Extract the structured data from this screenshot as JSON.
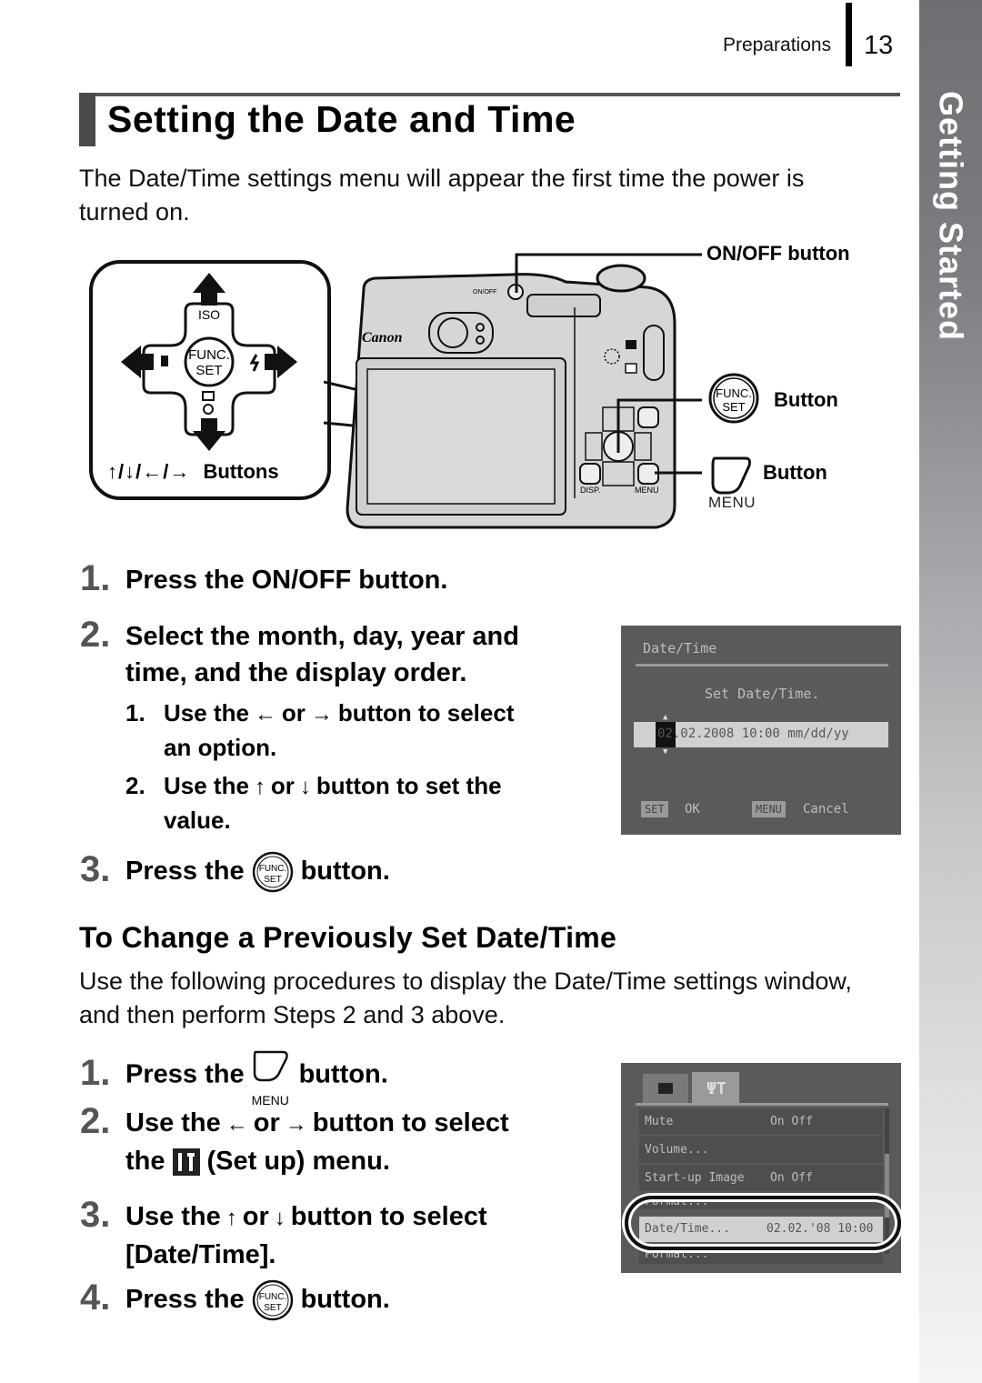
{
  "header": {
    "section": "Preparations",
    "page_number": "13"
  },
  "side_tab": {
    "label": "Getting Started"
  },
  "title": "Setting the Date and Time",
  "intro": "The Date/Time settings menu will appear the first time the power is turned on.",
  "diagram": {
    "dpad": {
      "caption_arrows": "↑/↓/←/→",
      "caption_label": "Buttons",
      "center_label_top": "FUNC.",
      "center_label_bottom": "SET",
      "up_label": "ISO"
    },
    "camera": {
      "brand": "Canon",
      "onoff_text": "ON/OFF",
      "disp_text": "DISP.",
      "menu_text": "MENU"
    },
    "callouts": {
      "onoff": "ON/OFF button",
      "func_set": "Button",
      "menu": "Button",
      "menu_under": "MENU",
      "func_top": "FUNC.",
      "func_bottom": "SET"
    }
  },
  "steps_main": [
    {
      "num": "1.",
      "text": "Press the ON/OFF button."
    },
    {
      "num": "2.",
      "text_line1": "Select the month, day, year and",
      "text_line2": "time, and the display order.",
      "substeps": [
        {
          "num": "1.",
          "pre": "Use the",
          "icon1": "←",
          "mid": "or",
          "icon2": "→",
          "post": "button to select",
          "line2": "an option."
        },
        {
          "num": "2.",
          "pre": "Use the",
          "icon1": "↑",
          "mid": "or",
          "icon2": "↓",
          "post": "button to set the",
          "line2": "value."
        }
      ]
    },
    {
      "num": "3.",
      "pre": "Press the",
      "post": "button."
    }
  ],
  "lcd_datetime": {
    "title": "Date/Time",
    "prompt": "Set Date/Time.",
    "value": "02.02.2008 10:00 mm/dd/yy",
    "ok_key": "SET",
    "ok_label": "OK",
    "cancel_key": "MENU",
    "cancel_label": "Cancel"
  },
  "section2": {
    "title": "To Change a Previously Set Date/Time",
    "body": "Use the following procedures to display the Date/Time settings window, and then perform Steps 2 and 3 above."
  },
  "steps_change": [
    {
      "num": "1.",
      "pre": "Press the",
      "icon_under": "MENU",
      "post": "button."
    },
    {
      "num": "2.",
      "pre": "Use the",
      "icon1": "←",
      "mid": "or",
      "icon2": "→",
      "post": "button to select",
      "line2_pre": "the",
      "line2_post": "(Set up) menu."
    },
    {
      "num": "3.",
      "pre": "Use the",
      "icon1": "↑",
      "mid": "or",
      "icon2": "↓",
      "post": "button to select",
      "line2": "[Date/Time]."
    },
    {
      "num": "4.",
      "pre": "Press the",
      "post": "button."
    }
  ],
  "lcd_setup": {
    "tabs": [
      "camera",
      "setup"
    ],
    "rows": [
      {
        "label": "Mute",
        "value": "On  Off"
      },
      {
        "label": "Volume...",
        "value": ""
      },
      {
        "label": "Start-up Image",
        "value": "On  Off"
      },
      {
        "label": "Format...",
        "value": ""
      },
      {
        "label": "Date/Time...",
        "value": "02.02.'08 10:00",
        "highlighted": true
      },
      {
        "label": "Format...",
        "value": ""
      }
    ]
  },
  "colors": {
    "side_tab_top": "#6e6f73",
    "side_tab_bottom": "#f4f5f5",
    "title_bar": "#4a4a4a",
    "step_number": "#555555",
    "lcd_bg": "#5a5a5a"
  }
}
